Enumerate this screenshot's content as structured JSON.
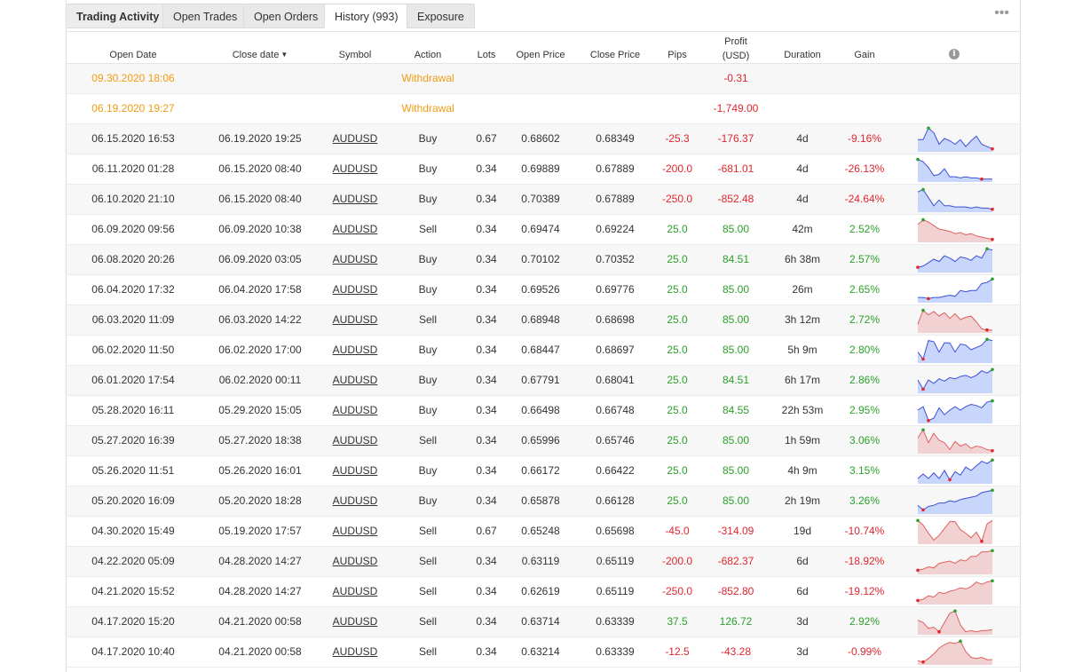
{
  "tabs": {
    "trading_activity": "Trading Activity",
    "open_trades": "Open Trades",
    "open_orders": "Open Orders",
    "history": "History (993)",
    "exposure": "Exposure",
    "more": "•••"
  },
  "columns": {
    "open_date": "Open Date",
    "close_date": "Close date",
    "sort_indicator": "▼",
    "symbol": "Symbol",
    "action": "Action",
    "lots": "Lots",
    "open_price": "Open Price",
    "close_price": "Close Price",
    "pips": "Pips",
    "profit_line1": "Profit",
    "profit_line2": "(USD)",
    "duration": "Duration",
    "gain": "Gain",
    "info": "i"
  },
  "colors": {
    "positive": "#2ca02c",
    "negative": "#e0262f",
    "withdrawal": "#f39c12",
    "buy_line": "#3a4fd6",
    "buy_fill": "#c9d6fb",
    "sell_line": "#e06060",
    "sell_fill": "#f1d1d1"
  },
  "rows": [
    {
      "open_date": "09.30.2020 18:06",
      "close_date": "",
      "symbol": "",
      "action": "Withdrawal",
      "lots": "",
      "open_price": "",
      "close_price": "",
      "pips": "",
      "profit": "-0.31",
      "duration": "",
      "gain": "",
      "type": "withdrawal"
    },
    {
      "open_date": "06.19.2020 19:27",
      "close_date": "",
      "symbol": "",
      "action": "Withdrawal",
      "lots": "",
      "open_price": "",
      "close_price": "",
      "pips": "",
      "profit": "-1,749.00",
      "duration": "",
      "gain": "",
      "type": "withdrawal"
    },
    {
      "open_date": "06.15.2020 16:53",
      "close_date": "06.19.2020 19:25",
      "symbol": "AUDUSD",
      "action": "Buy",
      "lots": "0.67",
      "open_price": "0.68602",
      "close_price": "0.68349",
      "pips": "-25.3",
      "profit": "-176.37",
      "duration": "4d",
      "gain": "-9.16%",
      "type": "trade",
      "spark": [
        0.55,
        0.55,
        0.05,
        0.25,
        0.75,
        0.5,
        0.6,
        0.75,
        0.55,
        0.85,
        0.6,
        0.4,
        0.75,
        0.85,
        0.95
      ]
    },
    {
      "open_date": "06.11.2020 01:28",
      "close_date": "06.15.2020 08:40",
      "symbol": "AUDUSD",
      "action": "Buy",
      "lots": "0.34",
      "open_price": "0.69889",
      "close_price": "0.67889",
      "pips": "-200.0",
      "profit": "-681.01",
      "duration": "4d",
      "gain": "-26.13%",
      "type": "trade",
      "spark": [
        0.1,
        0.2,
        0.45,
        0.8,
        0.75,
        0.5,
        0.85,
        0.85,
        0.9,
        0.85,
        0.9,
        0.9,
        0.95,
        0.95,
        0.95
      ]
    },
    {
      "open_date": "06.10.2020 21:10",
      "close_date": "06.15.2020 08:40",
      "symbol": "AUDUSD",
      "action": "Buy",
      "lots": "0.34",
      "open_price": "0.70389",
      "close_price": "0.67889",
      "pips": "-250.0",
      "profit": "-852.48",
      "duration": "4d",
      "gain": "-24.64%",
      "type": "trade",
      "spark": [
        0.2,
        0.1,
        0.45,
        0.8,
        0.55,
        0.8,
        0.8,
        0.85,
        0.85,
        0.85,
        0.9,
        0.85,
        0.9,
        0.9,
        0.95
      ]
    },
    {
      "open_date": "06.09.2020 09:56",
      "close_date": "06.09.2020 10:38",
      "symbol": "AUDUSD",
      "action": "Sell",
      "lots": "0.34",
      "open_price": "0.69474",
      "close_price": "0.69224",
      "pips": "25.0",
      "profit": "85.00",
      "duration": "42m",
      "gain": "2.52%",
      "type": "trade",
      "spark": [
        0.3,
        0.1,
        0.2,
        0.35,
        0.5,
        0.55,
        0.6,
        0.7,
        0.65,
        0.75,
        0.7,
        0.8,
        0.85,
        0.9,
        0.95
      ]
    },
    {
      "open_date": "06.08.2020 20:26",
      "close_date": "06.09.2020 03:05",
      "symbol": "AUDUSD",
      "action": "Buy",
      "lots": "0.34",
      "open_price": "0.70102",
      "close_price": "0.70352",
      "pips": "25.0",
      "profit": "84.51",
      "duration": "6h 38m",
      "gain": "2.57%",
      "type": "trade",
      "spark": [
        0.85,
        0.8,
        0.65,
        0.5,
        0.6,
        0.35,
        0.45,
        0.6,
        0.4,
        0.45,
        0.55,
        0.35,
        0.45,
        0.05,
        0.1
      ]
    },
    {
      "open_date": "06.04.2020 17:32",
      "close_date": "06.04.2020 17:58",
      "symbol": "AUDUSD",
      "action": "Buy",
      "lots": "0.34",
      "open_price": "0.69526",
      "close_price": "0.69776",
      "pips": "25.0",
      "profit": "85.00",
      "duration": "26m",
      "gain": "2.65%",
      "type": "trade",
      "spark": [
        0.85,
        0.85,
        0.9,
        0.85,
        0.85,
        0.8,
        0.75,
        0.8,
        0.55,
        0.6,
        0.55,
        0.55,
        0.25,
        0.2,
        0.05
      ]
    },
    {
      "open_date": "06.03.2020 11:09",
      "close_date": "06.03.2020 14:22",
      "symbol": "AUDUSD",
      "action": "Sell",
      "lots": "0.34",
      "open_price": "0.68948",
      "close_price": "0.68698",
      "pips": "25.0",
      "profit": "85.00",
      "duration": "3h 12m",
      "gain": "2.72%",
      "type": "trade",
      "spark": [
        0.7,
        0.1,
        0.3,
        0.15,
        0.35,
        0.2,
        0.45,
        0.25,
        0.5,
        0.4,
        0.35,
        0.6,
        0.9,
        0.95,
        0.95
      ]
    },
    {
      "open_date": "06.02.2020 11:50",
      "close_date": "06.02.2020 17:00",
      "symbol": "AUDUSD",
      "action": "Buy",
      "lots": "0.34",
      "open_price": "0.68447",
      "close_price": "0.68697",
      "pips": "25.0",
      "profit": "85.00",
      "duration": "5h 9m",
      "gain": "2.80%",
      "type": "trade",
      "spark": [
        0.6,
        0.9,
        0.1,
        0.15,
        0.6,
        0.2,
        0.2,
        0.6,
        0.25,
        0.3,
        0.5,
        0.4,
        0.3,
        0.05,
        0.1
      ]
    },
    {
      "open_date": "06.01.2020 17:54",
      "close_date": "06.02.2020 00:11",
      "symbol": "AUDUSD",
      "action": "Buy",
      "lots": "0.34",
      "open_price": "0.67791",
      "close_price": "0.68041",
      "pips": "25.0",
      "profit": "84.51",
      "duration": "6h 17m",
      "gain": "2.86%",
      "type": "trade",
      "spark": [
        0.5,
        0.9,
        0.5,
        0.65,
        0.45,
        0.55,
        0.4,
        0.45,
        0.35,
        0.3,
        0.4,
        0.3,
        0.1,
        0.2,
        0.05
      ]
    },
    {
      "open_date": "05.28.2020 16:11",
      "close_date": "05.29.2020 15:05",
      "symbol": "AUDUSD",
      "action": "Buy",
      "lots": "0.34",
      "open_price": "0.66498",
      "close_price": "0.66748",
      "pips": "25.0",
      "profit": "84.55",
      "duration": "22h 53m",
      "gain": "2.95%",
      "type": "trade",
      "spark": [
        0.5,
        0.35,
        0.95,
        0.85,
        0.4,
        0.7,
        0.5,
        0.35,
        0.5,
        0.35,
        0.25,
        0.3,
        0.4,
        0.15,
        0.1
      ]
    },
    {
      "open_date": "05.27.2020 16:39",
      "close_date": "05.27.2020 18:38",
      "symbol": "AUDUSD",
      "action": "Sell",
      "lots": "0.34",
      "open_price": "0.65996",
      "close_price": "0.65746",
      "pips": "25.0",
      "profit": "85.00",
      "duration": "1h 59m",
      "gain": "3.06%",
      "type": "trade",
      "spark": [
        0.4,
        0.05,
        0.6,
        0.2,
        0.5,
        0.6,
        0.9,
        0.55,
        0.75,
        0.65,
        0.85,
        0.75,
        0.8,
        0.9,
        0.95
      ]
    },
    {
      "open_date": "05.26.2020 11:51",
      "close_date": "05.26.2020 16:01",
      "symbol": "AUDUSD",
      "action": "Buy",
      "lots": "0.34",
      "open_price": "0.66172",
      "close_price": "0.66422",
      "pips": "25.0",
      "profit": "85.00",
      "duration": "4h 9m",
      "gain": "3.15%",
      "type": "trade",
      "spark": [
        0.85,
        0.65,
        0.85,
        0.6,
        0.85,
        0.5,
        0.9,
        0.55,
        0.7,
        0.35,
        0.5,
        0.3,
        0.1,
        0.2,
        0.05
      ]
    },
    {
      "open_date": "05.20.2020 16:09",
      "close_date": "05.20.2020 18:28",
      "symbol": "AUDUSD",
      "action": "Buy",
      "lots": "0.34",
      "open_price": "0.65878",
      "close_price": "0.66128",
      "pips": "25.0",
      "profit": "85.00",
      "duration": "2h 19m",
      "gain": "3.26%",
      "type": "trade",
      "spark": [
        0.7,
        0.9,
        0.75,
        0.7,
        0.6,
        0.6,
        0.5,
        0.55,
        0.45,
        0.4,
        0.35,
        0.3,
        0.15,
        0.1,
        0.05
      ]
    },
    {
      "open_date": "04.30.2020 15:49",
      "close_date": "05.19.2020 17:57",
      "symbol": "AUDUSD",
      "action": "Sell",
      "lots": "0.67",
      "open_price": "0.65248",
      "close_price": "0.65698",
      "pips": "-45.0",
      "profit": "-314.09",
      "duration": "19d",
      "gain": "-10.74%",
      "type": "trade",
      "spark": [
        0.05,
        0.25,
        0.6,
        0.9,
        0.7,
        0.4,
        0.1,
        0.1,
        0.45,
        0.6,
        0.8,
        0.55,
        0.95,
        0.2,
        0.05
      ]
    },
    {
      "open_date": "04.22.2020 05:09",
      "close_date": "04.28.2020 14:27",
      "symbol": "AUDUSD",
      "action": "Sell",
      "lots": "0.34",
      "open_price": "0.63119",
      "close_price": "0.65119",
      "pips": "-200.0",
      "profit": "-682.37",
      "duration": "6d",
      "gain": "-18.92%",
      "type": "trade",
      "spark": [
        0.9,
        0.85,
        0.75,
        0.8,
        0.6,
        0.55,
        0.5,
        0.6,
        0.45,
        0.5,
        0.3,
        0.3,
        0.1,
        0.1,
        0.05
      ]
    },
    {
      "open_date": "04.21.2020 15:52",
      "close_date": "04.28.2020 14:27",
      "symbol": "AUDUSD",
      "action": "Sell",
      "lots": "0.34",
      "open_price": "0.62619",
      "close_price": "0.65119",
      "pips": "-250.0",
      "profit": "-852.80",
      "duration": "6d",
      "gain": "-19.12%",
      "type": "trade",
      "spark": [
        0.9,
        0.85,
        0.7,
        0.75,
        0.55,
        0.6,
        0.5,
        0.45,
        0.35,
        0.4,
        0.3,
        0.1,
        0.2,
        0.1,
        0.05
      ]
    },
    {
      "open_date": "04.17.2020 15:20",
      "close_date": "04.21.2020 00:58",
      "symbol": "AUDUSD",
      "action": "Sell",
      "lots": "0.34",
      "open_price": "0.63714",
      "close_price": "0.63339",
      "pips": "37.5",
      "profit": "126.72",
      "duration": "3d",
      "gain": "2.92%",
      "type": "trade",
      "spark": [
        0.45,
        0.55,
        0.8,
        0.75,
        0.95,
        0.55,
        0.15,
        0.05,
        0.65,
        0.95,
        0.9,
        0.95,
        0.9,
        0.9,
        0.85
      ]
    },
    {
      "open_date": "04.17.2020 10:40",
      "close_date": "04.21.2020 00:58",
      "symbol": "AUDUSD",
      "action": "Sell",
      "lots": "0.34",
      "open_price": "0.63214",
      "close_price": "0.63339",
      "pips": "-12.5",
      "profit": "-43.28",
      "duration": "3d",
      "gain": "-0.99%",
      "type": "trade",
      "spark": [
        0.9,
        0.95,
        0.8,
        0.6,
        0.35,
        0.2,
        0.1,
        0.15,
        0.05,
        0.5,
        0.75,
        0.8,
        0.75,
        0.85,
        0.85
      ]
    }
  ]
}
